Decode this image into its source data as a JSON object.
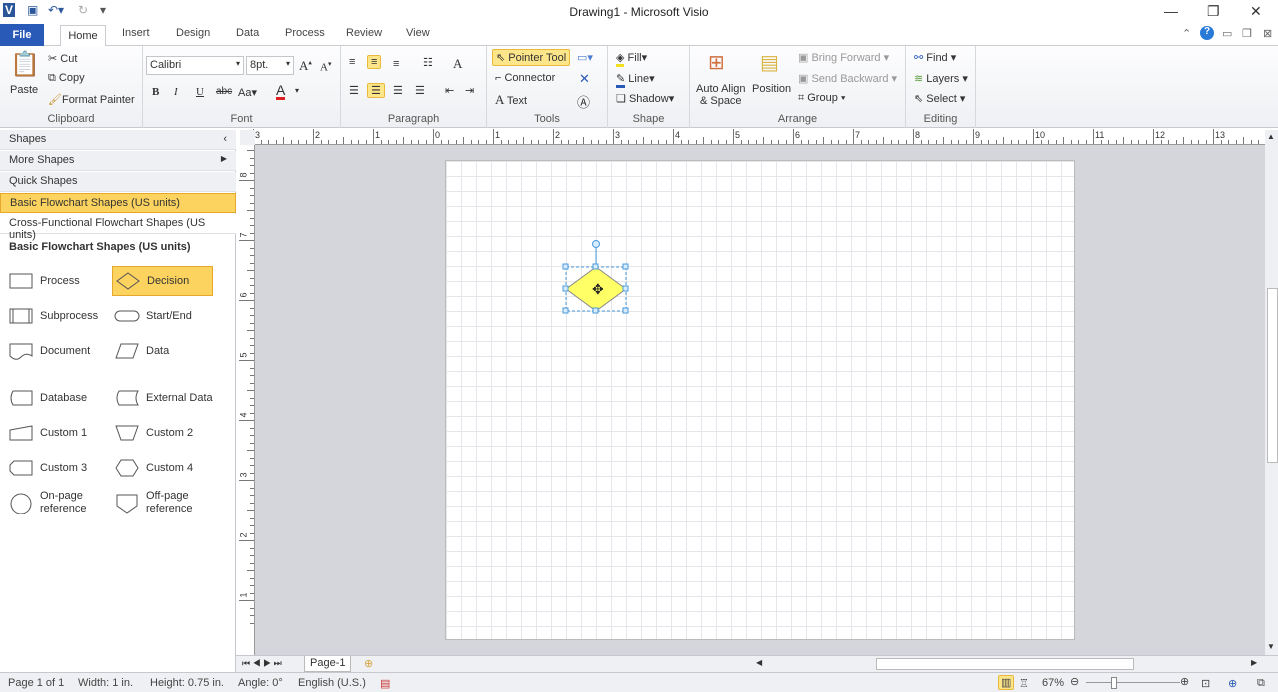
{
  "window": {
    "title": "Drawing1 - Microsoft Visio"
  },
  "tabs": [
    "File",
    "Home",
    "Insert",
    "Design",
    "Data",
    "Process",
    "Review",
    "View"
  ],
  "ribbon": {
    "clipboard": {
      "label": "Clipboard",
      "paste": "Paste",
      "cut": "Cut",
      "copy": "Copy",
      "format_painter": "Format Painter"
    },
    "font": {
      "label": "Font",
      "font_name": "Calibri",
      "font_size": "8pt.",
      "bold": "B",
      "italic": "I",
      "underline": "U",
      "strike": "abc",
      "case": "Aa",
      "color": "#e02020"
    },
    "paragraph": {
      "label": "Paragraph"
    },
    "tools": {
      "label": "Tools",
      "pointer": "Pointer Tool",
      "connector": "Connector",
      "text": "Text"
    },
    "shape": {
      "label": "Shape",
      "fill": "Fill",
      "line": "Line",
      "shadow": "Shadow"
    },
    "arrange": {
      "label": "Arrange",
      "auto_align": "Auto Align",
      "auto_align2": "& Space",
      "position": "Position",
      "bring_forward": "Bring Forward",
      "send_backward": "Send Backward",
      "group": "Group"
    },
    "editing": {
      "label": "Editing",
      "find": "Find",
      "layers": "Layers",
      "select": "Select"
    }
  },
  "shapes_panel": {
    "title": "Shapes",
    "more": "More Shapes",
    "quick": "Quick Shapes",
    "stencils": [
      "Basic Flowchart Shapes (US units)",
      "Cross-Functional Flowchart Shapes (US units)"
    ],
    "section": "Basic Flowchart Shapes (US units)",
    "items": [
      {
        "label": "Process",
        "icon": "rect"
      },
      {
        "label": "Decision",
        "icon": "diamond"
      },
      {
        "label": "Subprocess",
        "icon": "subprocess"
      },
      {
        "label": "Start/End",
        "icon": "terminator"
      },
      {
        "label": "Document",
        "icon": "document"
      },
      {
        "label": "Data",
        "icon": "parallelogram"
      },
      {
        "label": "Database",
        "icon": "database"
      },
      {
        "label": "External Data",
        "icon": "external"
      },
      {
        "label": "Custom 1",
        "icon": "custom1"
      },
      {
        "label": "Custom 2",
        "icon": "trapezoid"
      },
      {
        "label": "Custom 3",
        "icon": "custom3"
      },
      {
        "label": "Custom 4",
        "icon": "hexagon"
      },
      {
        "label": "On-page reference",
        "icon": "circle"
      },
      {
        "label": "Off-page reference",
        "icon": "offpage"
      }
    ]
  },
  "rulers": {
    "h": [
      "3",
      "2",
      "1",
      "0",
      "1",
      "2",
      "3",
      "4",
      "5",
      "6",
      "7",
      "8",
      "9",
      "10",
      "11",
      "12",
      "13"
    ],
    "v": [
      "8",
      "7",
      "6",
      "5",
      "4",
      "3",
      "2",
      "1"
    ]
  },
  "drawing": {
    "shape": "Decision",
    "fill": "#ffff66"
  },
  "pages": {
    "tab": "Page-1"
  },
  "status": {
    "page": "Page 1 of 1",
    "width": "Width: 1 in.",
    "height": "Height: 0.75 in.",
    "angle": "Angle: 0°",
    "language": "English (U.S.)",
    "zoom": "67%",
    "zoom_percent": 67
  },
  "colors": {
    "accent": "#2a5ab8",
    "highlight": "#fde58a"
  }
}
